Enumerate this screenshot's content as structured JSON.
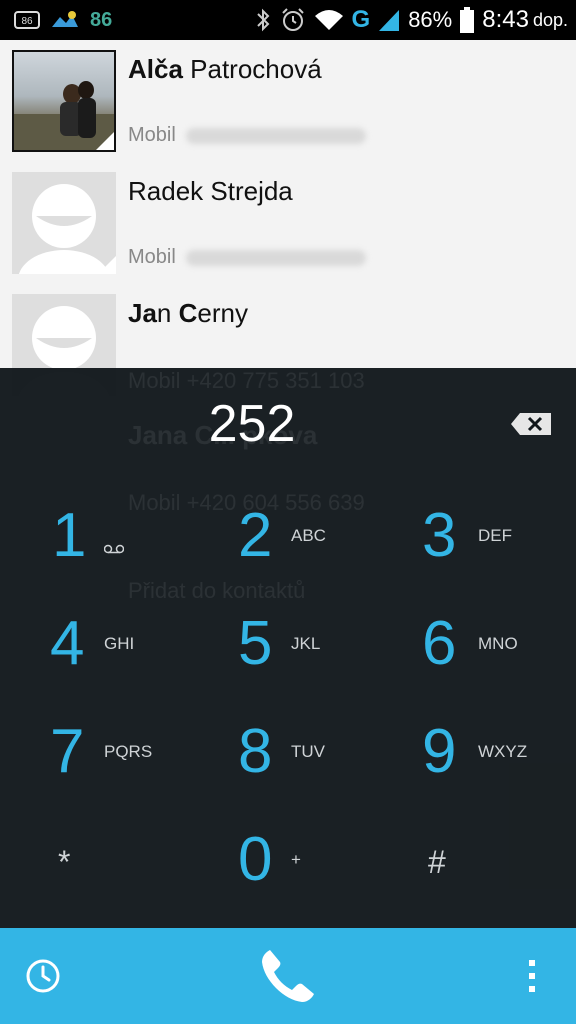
{
  "status_bar": {
    "left_number": "86",
    "carrier_letter": "G",
    "battery_text": "86%",
    "time": "8:43",
    "ampm": "dop."
  },
  "contacts": [
    {
      "name_bold": "Alča",
      "name_rest": " Patrochová",
      "label": "Mobil",
      "photo": true
    },
    {
      "name_bold": "",
      "name_rest": "Radek Strejda",
      "label": "Mobil",
      "photo": false
    },
    {
      "name_bold": "Ja",
      "name_rest": "n ",
      "name_bold2": "C",
      "name_rest2": "erny",
      "label": "Mobil",
      "photo": false
    }
  ],
  "behind_text": {
    "c3_phone": "Mobil +420 775 351 103",
    "c4_name": "Jana C... pkova",
    "c4_phone": "Mobil +420 604 556 639",
    "add_contact": "Přidat do kontaktů"
  },
  "dialpad": {
    "typed_digits": "252",
    "keys": [
      {
        "num": "1",
        "letters": ""
      },
      {
        "num": "2",
        "letters": "ABC"
      },
      {
        "num": "3",
        "letters": "DEF"
      },
      {
        "num": "4",
        "letters": "GHI"
      },
      {
        "num": "5",
        "letters": "JKL"
      },
      {
        "num": "6",
        "letters": "MNO"
      },
      {
        "num": "7",
        "letters": "PQRS"
      },
      {
        "num": "8",
        "letters": "TUV"
      },
      {
        "num": "9",
        "letters": "WXYZ"
      },
      {
        "num": "*",
        "letters": ""
      },
      {
        "num": "0",
        "letters": "+"
      },
      {
        "num": "#",
        "letters": ""
      }
    ]
  },
  "colors": {
    "accent": "#33b5e5",
    "dialpad_bg": "#11171b",
    "list_bg": "#f3f3f3"
  },
  "icons": {
    "history": "clock-icon",
    "call": "phone-icon",
    "menu": "overflow-menu-icon",
    "delete": "backspace-icon",
    "voicemail": "voicemail-icon"
  }
}
